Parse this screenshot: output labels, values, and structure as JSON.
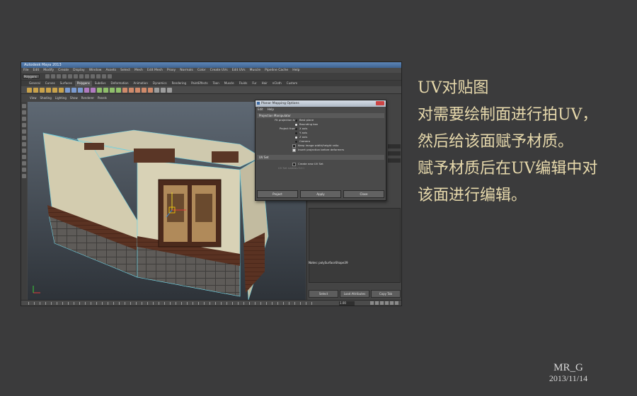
{
  "app": {
    "window_title": "Autodesk Maya 2013",
    "menu": [
      "File",
      "Edit",
      "Modify",
      "Create",
      "Display",
      "Window",
      "Assets",
      "Select",
      "Mesh",
      "Edit Mesh",
      "Proxy",
      "Normals",
      "Color",
      "Create UVs",
      "Edit UVs",
      "Muscle",
      "Pipeline Cache",
      "Help"
    ],
    "mode": "Polygons",
    "shelf_tabs": [
      "General",
      "Curves",
      "Surfaces",
      "Polygons",
      "Subdivs",
      "Deformation",
      "Animation",
      "Dynamics",
      "Rendering",
      "PaintEffects",
      "Toon",
      "Muscle",
      "Fluids",
      "Fur",
      "Hair",
      "nCloth",
      "Custom"
    ],
    "active_shelf_tab": "Polygons",
    "viewport_menu": [
      "View",
      "Shading",
      "Lighting",
      "Show",
      "Renderer",
      "Panels"
    ],
    "current_frame": "1.00"
  },
  "dialog": {
    "title": "Planar Mapping Options",
    "menu": [
      "Edit",
      "Help"
    ],
    "section_projection": "Projection Manipulator",
    "fit_label": "Fit projection to:",
    "fit_options": [
      "Best plane",
      "Bounding box"
    ],
    "fit_selected": "Bounding box",
    "project_label": "Project from:",
    "project_options": [
      "X axis",
      "Y axis",
      "Z axis",
      "Camera"
    ],
    "keep_width_label": "Keep image width/height ratio",
    "insert_label": "Insert projection before deformers",
    "section_uvset": "UV Set",
    "create_uvset_label": "Create new UV Set",
    "uvset_name_label": "UV Set name:",
    "uvset_name_value": "uvSet1",
    "buttons": [
      "Project",
      "Apply",
      "Close"
    ]
  },
  "side_panel": {
    "notes_label": "Notes: polySurfaceShape39",
    "buttons": [
      "Select",
      "Load Attributes",
      "Copy Tab"
    ]
  },
  "caption": {
    "lines": [
      "UV对贴图",
      "对需要绘制面进行拍UV，",
      "然后给该面赋予材质。",
      "赋予材质后在UV编辑中对",
      "该面进行编辑。"
    ]
  },
  "signature": {
    "name": "MR_G",
    "date": "2013/11/14"
  }
}
